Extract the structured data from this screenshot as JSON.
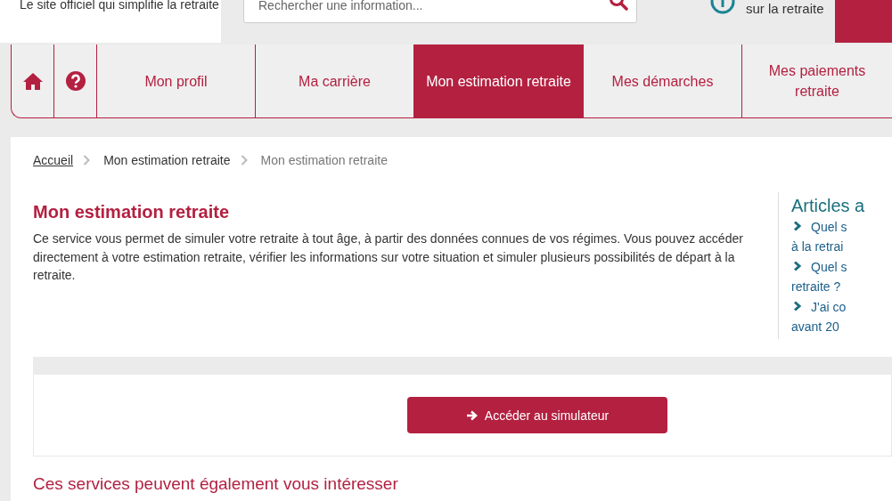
{
  "header": {
    "tagline": "Le site officiel qui simplifie la retraite",
    "search": {
      "placeholder": "Rechercher une information..."
    },
    "info_link": "sur la retraite"
  },
  "nav": [
    {
      "kind": "home",
      "selected": false
    },
    {
      "kind": "help",
      "selected": false
    },
    {
      "kind": "text",
      "label": "Mon profil",
      "selected": false
    },
    {
      "kind": "text",
      "label": "Ma carrière",
      "selected": false
    },
    {
      "kind": "text",
      "label": "Mon estimation retraite",
      "selected": true
    },
    {
      "kind": "text",
      "label": "Mes démarches",
      "selected": false
    },
    {
      "kind": "text",
      "label": "Mes paiements retraite",
      "selected": false
    }
  ],
  "breadcrumb": [
    {
      "label": "Accueil",
      "link": true
    },
    {
      "label": "Mon estimation retraite",
      "link": false
    },
    {
      "label": "Mon estimation retraite",
      "link": false
    }
  ],
  "title": "Mon estimation retraite",
  "intro": "Ce service vous permet de simuler votre retraite à tout âge, à partir des données connues de vos régimes. Vous pouvez accéder directement à votre estimation retraite, vérifier les informations sur votre situation et simuler plusieurs possibilités de départ à la retraite.",
  "articles": {
    "title": "Articles a",
    "links": [
      {
        "lines": [
          "Quel s",
          "à la retrai"
        ]
      },
      {
        "lines": [
          "Quel s",
          "retraite ?"
        ]
      },
      {
        "lines": [
          "J'ai co",
          "avant 20"
        ]
      }
    ]
  },
  "simulator_button": "Accéder au simulateur",
  "services_title": "Ces services peuvent également vous intéresser"
}
